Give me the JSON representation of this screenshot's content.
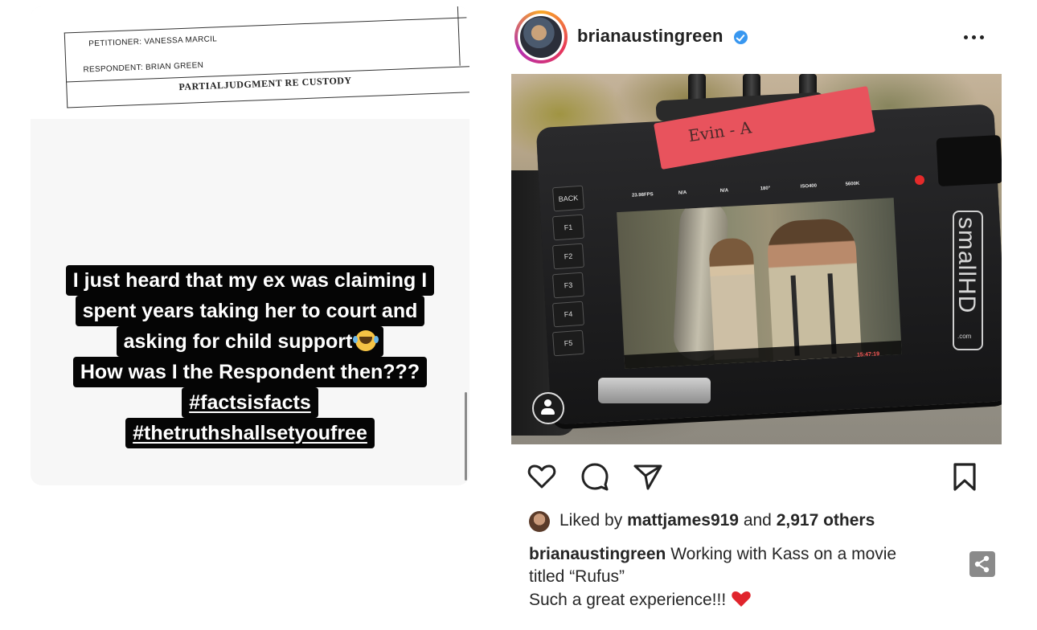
{
  "story": {
    "document": {
      "petitioner": "PETITIONER: VANESSA MARCIL",
      "respondent": "RESPONDENT: BRIAN GREEN",
      "title": "PARTIALJUDGMENT RE CUSTODY"
    },
    "caption_lines": [
      "I just heard that my ex was claiming I",
      "spent years taking her to court and",
      "asking for child support",
      "How was I the Respondent then???",
      "#factsisfacts",
      "#thetruthshallsetyoufree"
    ],
    "emoji": "face-with-tears-of-joy"
  },
  "post": {
    "username": "brianaustingreen",
    "verified": true,
    "photo": {
      "tape_label": "Evin - A",
      "monitor_brand": "smallHD",
      "monitor_brand_suffix": ".com",
      "osd_top": [
        "23.98FPS",
        "N/A",
        "N/A",
        "180°",
        "ISO400",
        "5600K"
      ],
      "side_buttons": [
        "BACK",
        "F1",
        "F2",
        "F3",
        "F4",
        "F5"
      ],
      "timecode": "15:47:19"
    },
    "actions": {
      "like_icon": "heart-outline-icon",
      "comment_icon": "comment-bubble-icon",
      "share_icon": "paper-plane-icon",
      "save_icon": "bookmark-icon"
    },
    "likes": {
      "prefix": "Liked by ",
      "user": "mattjames919",
      "middle": " and ",
      "others": "2,917 others"
    },
    "caption": {
      "user": "brianaustingreen",
      "line1": " Working with Kass on a movie",
      "line2": "titled “Rufus”",
      "line3": "Such a great experience!!!"
    }
  },
  "colors": {
    "caption_bg": "#050505",
    "verified": "#3897f0",
    "tape": "#e8535d",
    "heart": "#e0242c"
  }
}
